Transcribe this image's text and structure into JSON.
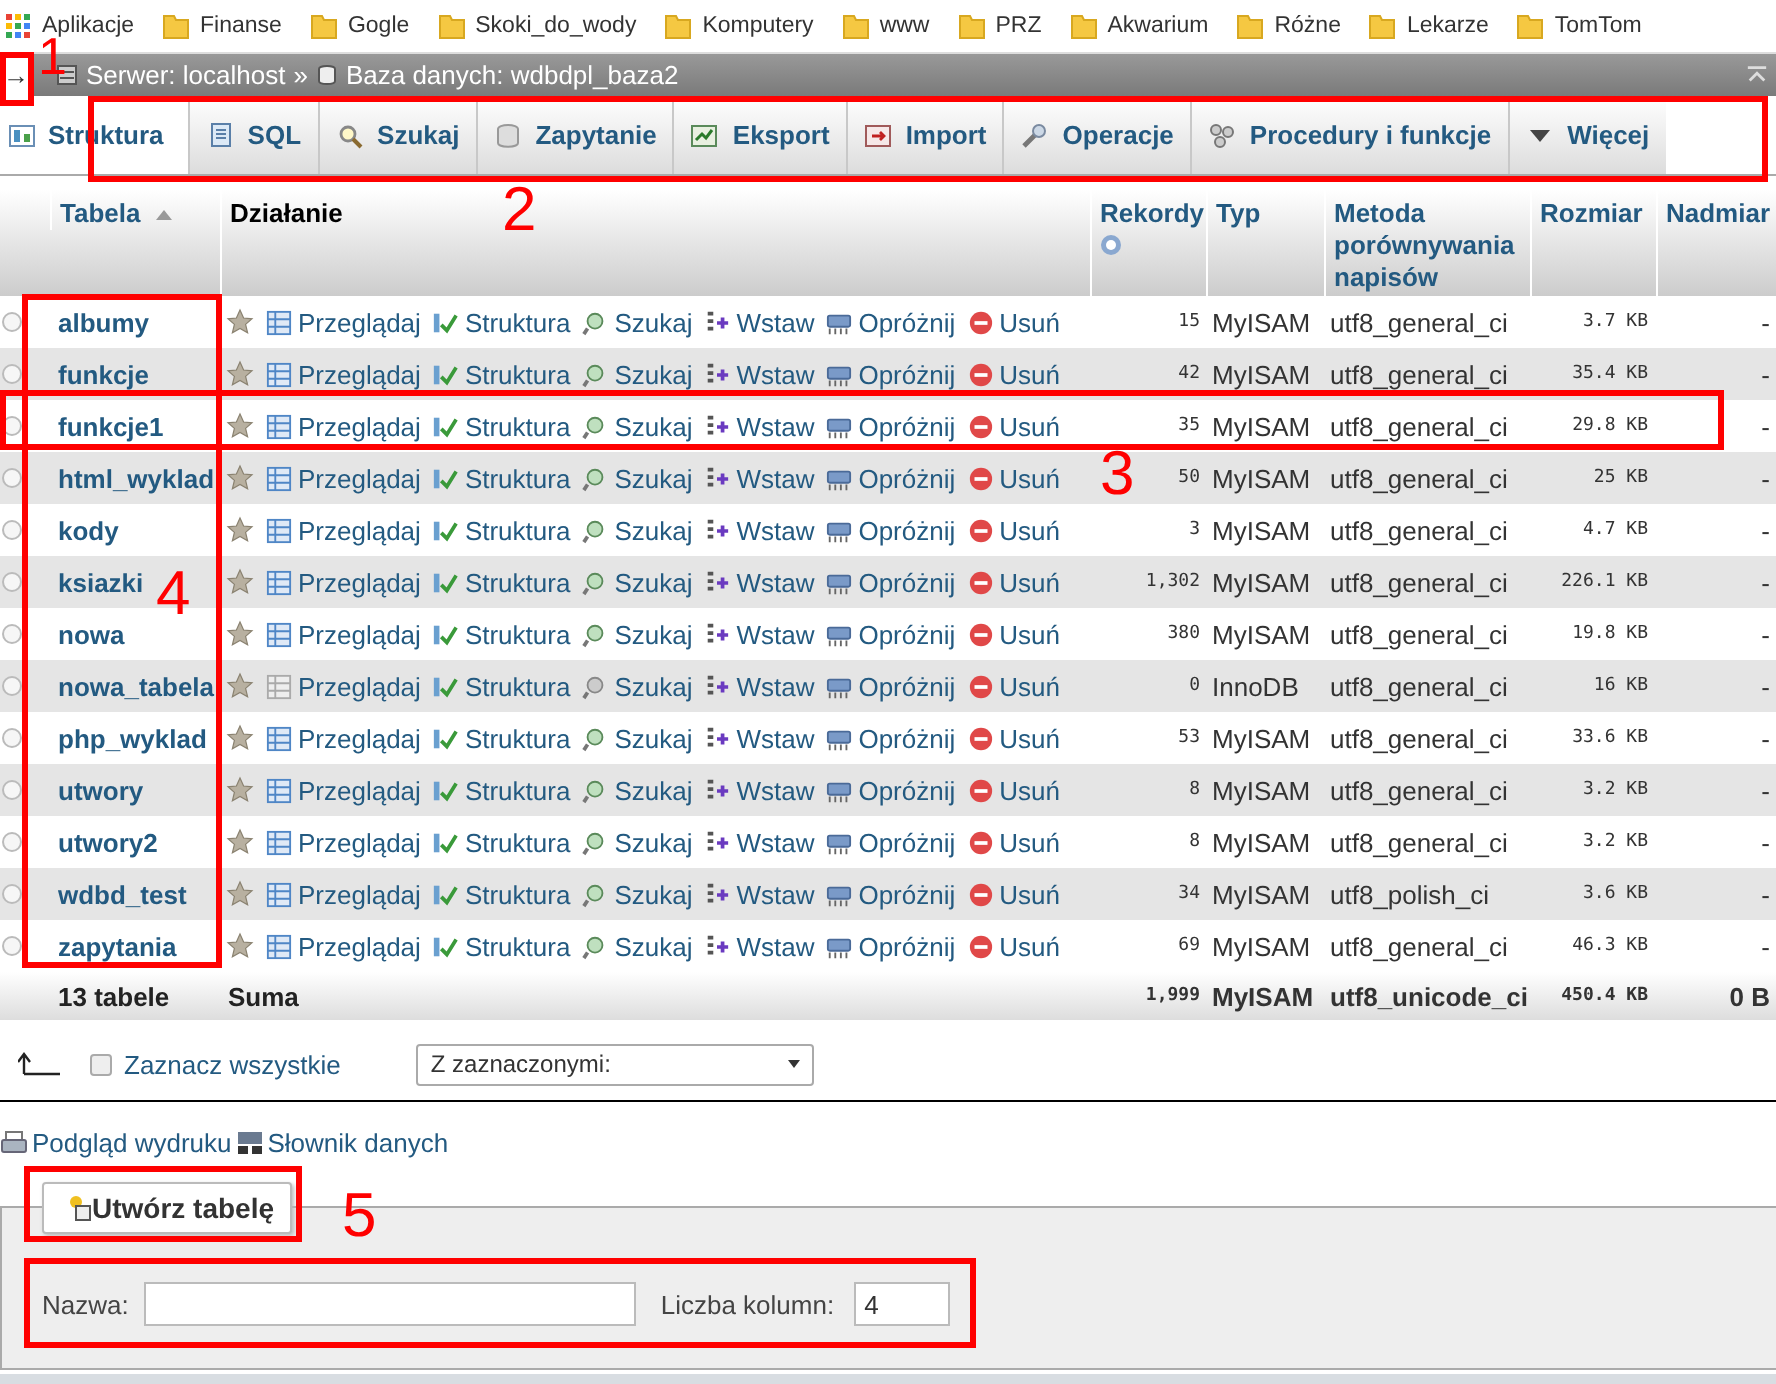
{
  "bookmarks": [
    {
      "kind": "apps",
      "label": "Aplikacje"
    },
    {
      "kind": "folder",
      "label": "Finanse"
    },
    {
      "kind": "folder",
      "label": "Gogle"
    },
    {
      "kind": "folder",
      "label": "Skoki_do_wody"
    },
    {
      "kind": "folder",
      "label": "Komputery"
    },
    {
      "kind": "folder",
      "label": "www"
    },
    {
      "kind": "folder",
      "label": "PRZ"
    },
    {
      "kind": "folder",
      "label": "Akwarium"
    },
    {
      "kind": "folder",
      "label": "Różne"
    },
    {
      "kind": "folder",
      "label": "Lekarze"
    },
    {
      "kind": "folder",
      "label": "TomTom"
    }
  ],
  "breadcrumb": {
    "toggle": "→",
    "server": "Serwer: localhost",
    "separator": "»",
    "database": "Baza danych: wdbdpl_baza2"
  },
  "tabs": [
    {
      "label": "Struktura",
      "selected": true
    },
    {
      "label": "SQL",
      "selected": false
    },
    {
      "label": "Szukaj",
      "selected": false
    },
    {
      "label": "Zapytanie",
      "selected": false
    },
    {
      "label": "Eksport",
      "selected": false
    },
    {
      "label": "Import",
      "selected": false
    },
    {
      "label": "Operacje",
      "selected": false
    },
    {
      "label": "Procedury i funkcje",
      "selected": false
    },
    {
      "label": "Więcej",
      "selected": false
    }
  ],
  "table": {
    "columns": [
      "Tabela",
      "Działanie",
      "Rekordy",
      "Typ",
      "Metoda porównywania napisów",
      "Rozmiar",
      "Nadmiar"
    ],
    "rows": [
      {
        "name": "albumy",
        "checked": false,
        "empty": false,
        "actions": [
          "Przeglądaj",
          "Struktura",
          "Szukaj",
          "Wstaw",
          "Opróżnij",
          "Usuń"
        ],
        "records": "15",
        "type": "MyISAM",
        "collation": "utf8_general_ci",
        "size": "3.7 KB",
        "overhead": "-"
      },
      {
        "name": "funkcje",
        "checked": false,
        "empty": false,
        "actions": [
          "Przeglądaj",
          "Struktura",
          "Szukaj",
          "Wstaw",
          "Opróżnij",
          "Usuń"
        ],
        "records": "42",
        "type": "MyISAM",
        "collation": "utf8_general_ci",
        "size": "35.4 KB",
        "overhead": "-"
      },
      {
        "name": "funkcje1",
        "checked": false,
        "empty": false,
        "actions": [
          "Przeglądaj",
          "Struktura",
          "Szukaj",
          "Wstaw",
          "Opróżnij",
          "Usuń"
        ],
        "records": "35",
        "type": "MyISAM",
        "collation": "utf8_general_ci",
        "size": "29.8 KB",
        "overhead": "-"
      },
      {
        "name": "html_wyklad",
        "checked": false,
        "empty": false,
        "actions": [
          "Przeglądaj",
          "Struktura",
          "Szukaj",
          "Wstaw",
          "Opróżnij",
          "Usuń"
        ],
        "records": "50",
        "type": "MyISAM",
        "collation": "utf8_general_ci",
        "size": "25 KB",
        "overhead": "-"
      },
      {
        "name": "kody",
        "checked": false,
        "empty": false,
        "actions": [
          "Przeglądaj",
          "Struktura",
          "Szukaj",
          "Wstaw",
          "Opróżnij",
          "Usuń"
        ],
        "records": "3",
        "type": "MyISAM",
        "collation": "utf8_general_ci",
        "size": "4.7 KB",
        "overhead": "-"
      },
      {
        "name": "ksiazki",
        "checked": false,
        "empty": false,
        "actions": [
          "Przeglądaj",
          "Struktura",
          "Szukaj",
          "Wstaw",
          "Opróżnij",
          "Usuń"
        ],
        "records": "1,302",
        "type": "MyISAM",
        "collation": "utf8_general_ci",
        "size": "226.1 KB",
        "overhead": "-"
      },
      {
        "name": "nowa",
        "checked": false,
        "empty": false,
        "actions": [
          "Przeglądaj",
          "Struktura",
          "Szukaj",
          "Wstaw",
          "Opróżnij",
          "Usuń"
        ],
        "records": "380",
        "type": "MyISAM",
        "collation": "utf8_general_ci",
        "size": "19.8 KB",
        "overhead": "-"
      },
      {
        "name": "nowa_tabela",
        "checked": false,
        "empty": true,
        "actions": [
          "Przeglądaj",
          "Struktura",
          "Szukaj",
          "Wstaw",
          "Opróżnij",
          "Usuń"
        ],
        "records": "0",
        "type": "InnoDB",
        "collation": "utf8_general_ci",
        "size": "16 KB",
        "overhead": "-"
      },
      {
        "name": "php_wyklad",
        "checked": false,
        "empty": false,
        "actions": [
          "Przeglądaj",
          "Struktura",
          "Szukaj",
          "Wstaw",
          "Opróżnij",
          "Usuń"
        ],
        "records": "53",
        "type": "MyISAM",
        "collation": "utf8_general_ci",
        "size": "33.6 KB",
        "overhead": "-"
      },
      {
        "name": "utwory",
        "checked": false,
        "empty": false,
        "actions": [
          "Przeglądaj",
          "Struktura",
          "Szukaj",
          "Wstaw",
          "Opróżnij",
          "Usuń"
        ],
        "records": "8",
        "type": "MyISAM",
        "collation": "utf8_general_ci",
        "size": "3.2 KB",
        "overhead": "-"
      },
      {
        "name": "utwory2",
        "checked": false,
        "empty": false,
        "actions": [
          "Przeglądaj",
          "Struktura",
          "Szukaj",
          "Wstaw",
          "Opróżnij",
          "Usuń"
        ],
        "records": "8",
        "type": "MyISAM",
        "collation": "utf8_general_ci",
        "size": "3.2 KB",
        "overhead": "-"
      },
      {
        "name": "wdbd_test",
        "checked": false,
        "empty": false,
        "actions": [
          "Przeglądaj",
          "Struktura",
          "Szukaj",
          "Wstaw",
          "Opróżnij",
          "Usuń"
        ],
        "records": "34",
        "type": "MyISAM",
        "collation": "utf8_polish_ci",
        "size": "3.6 KB",
        "overhead": "-"
      },
      {
        "name": "zapytania",
        "checked": false,
        "empty": false,
        "actions": [
          "Przeglądaj",
          "Struktura",
          "Szukaj",
          "Wstaw",
          "Opróżnij",
          "Usuń"
        ],
        "records": "69",
        "type": "MyISAM",
        "collation": "utf8_general_ci",
        "size": "46.3 KB",
        "overhead": "-"
      }
    ],
    "footer": {
      "count": "13 tabele",
      "label": "Suma",
      "records": "1,999",
      "type": "MyISAM",
      "collation": "utf8_unicode_ci",
      "size": "450.4 KB",
      "overhead": "0 B"
    }
  },
  "selection": {
    "check_all": "Zaznacz wszystkie",
    "checked": false,
    "bulk_action": "Z zaznaczonymi:"
  },
  "links": [
    "Podgląd wydruku",
    "Słownik danych"
  ],
  "create_table": {
    "button": "Utwórz tabelę",
    "name_label": "Nazwa:",
    "columns_label": "Liczba kolumn:",
    "columns_value": "4"
  },
  "annotations": [
    {
      "label": "1"
    },
    {
      "label": "2"
    },
    {
      "label": "3"
    },
    {
      "label": "4"
    },
    {
      "label": "5"
    }
  ]
}
